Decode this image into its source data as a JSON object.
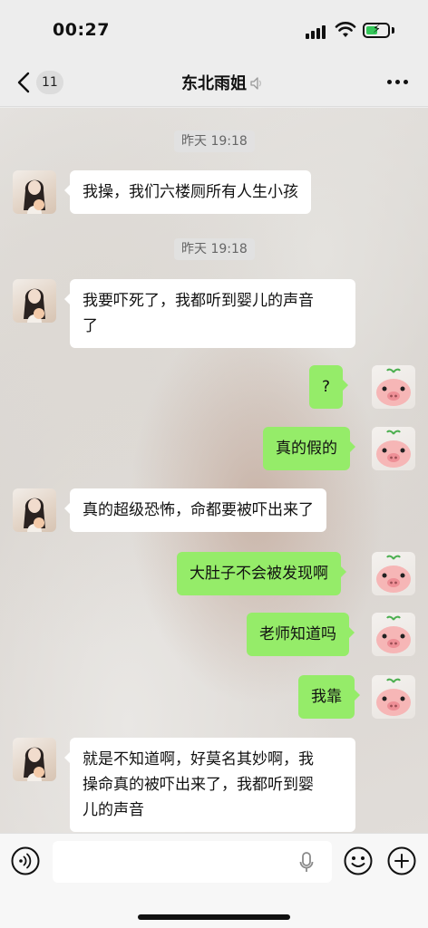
{
  "status_bar": {
    "time": "00:27",
    "icons": [
      "signal-icon",
      "wifi-icon",
      "battery-charging-icon"
    ]
  },
  "nav": {
    "back_icon": "chevron-left-icon",
    "unread_count": "11",
    "title": "东北雨姐",
    "title_suffix_icon": "mute-icon",
    "more_icon": "more-dots-icon"
  },
  "messages": [
    {
      "type": "timestamp",
      "text": "昨天 19:18"
    },
    {
      "type": "message",
      "side": "left",
      "avatar": "girl-avatar",
      "text": "我操，我们六楼厕所有人生小孩"
    },
    {
      "type": "timestamp",
      "text": "昨天 19:18"
    },
    {
      "type": "message",
      "side": "left",
      "avatar": "girl-avatar",
      "lines": [
        "我要吓死了，我都听到婴儿的声音",
        "了"
      ]
    },
    {
      "type": "message",
      "side": "right",
      "avatar": "pig-avatar",
      "text": "?"
    },
    {
      "type": "message",
      "side": "right",
      "avatar": "pig-avatar",
      "text": "真的假的"
    },
    {
      "type": "message",
      "side": "left",
      "avatar": "girl-avatar",
      "text": "真的超级恐怖，命都要被吓出来了"
    },
    {
      "type": "message",
      "side": "right",
      "avatar": "pig-avatar",
      "text": "大肚子不会被发现啊"
    },
    {
      "type": "message",
      "side": "right",
      "avatar": "pig-avatar",
      "text": "老师知道吗"
    },
    {
      "type": "message",
      "side": "right",
      "avatar": "pig-avatar",
      "text": "我靠"
    },
    {
      "type": "message",
      "side": "left",
      "avatar": "girl-avatar",
      "lines": [
        "就是不知道啊，好莫名其妙啊，我",
        "操命真的被吓出来了，我都听到婴",
        "儿的声音"
      ]
    }
  ],
  "input_bar": {
    "text_value": "",
    "icons": [
      "voice-icon",
      "mic-icon",
      "emoji-icon",
      "plus-icon"
    ]
  },
  "colors": {
    "sent_bubble": "#95ec69",
    "received_bubble": "#ffffff",
    "chrome_background": "#ededed"
  }
}
